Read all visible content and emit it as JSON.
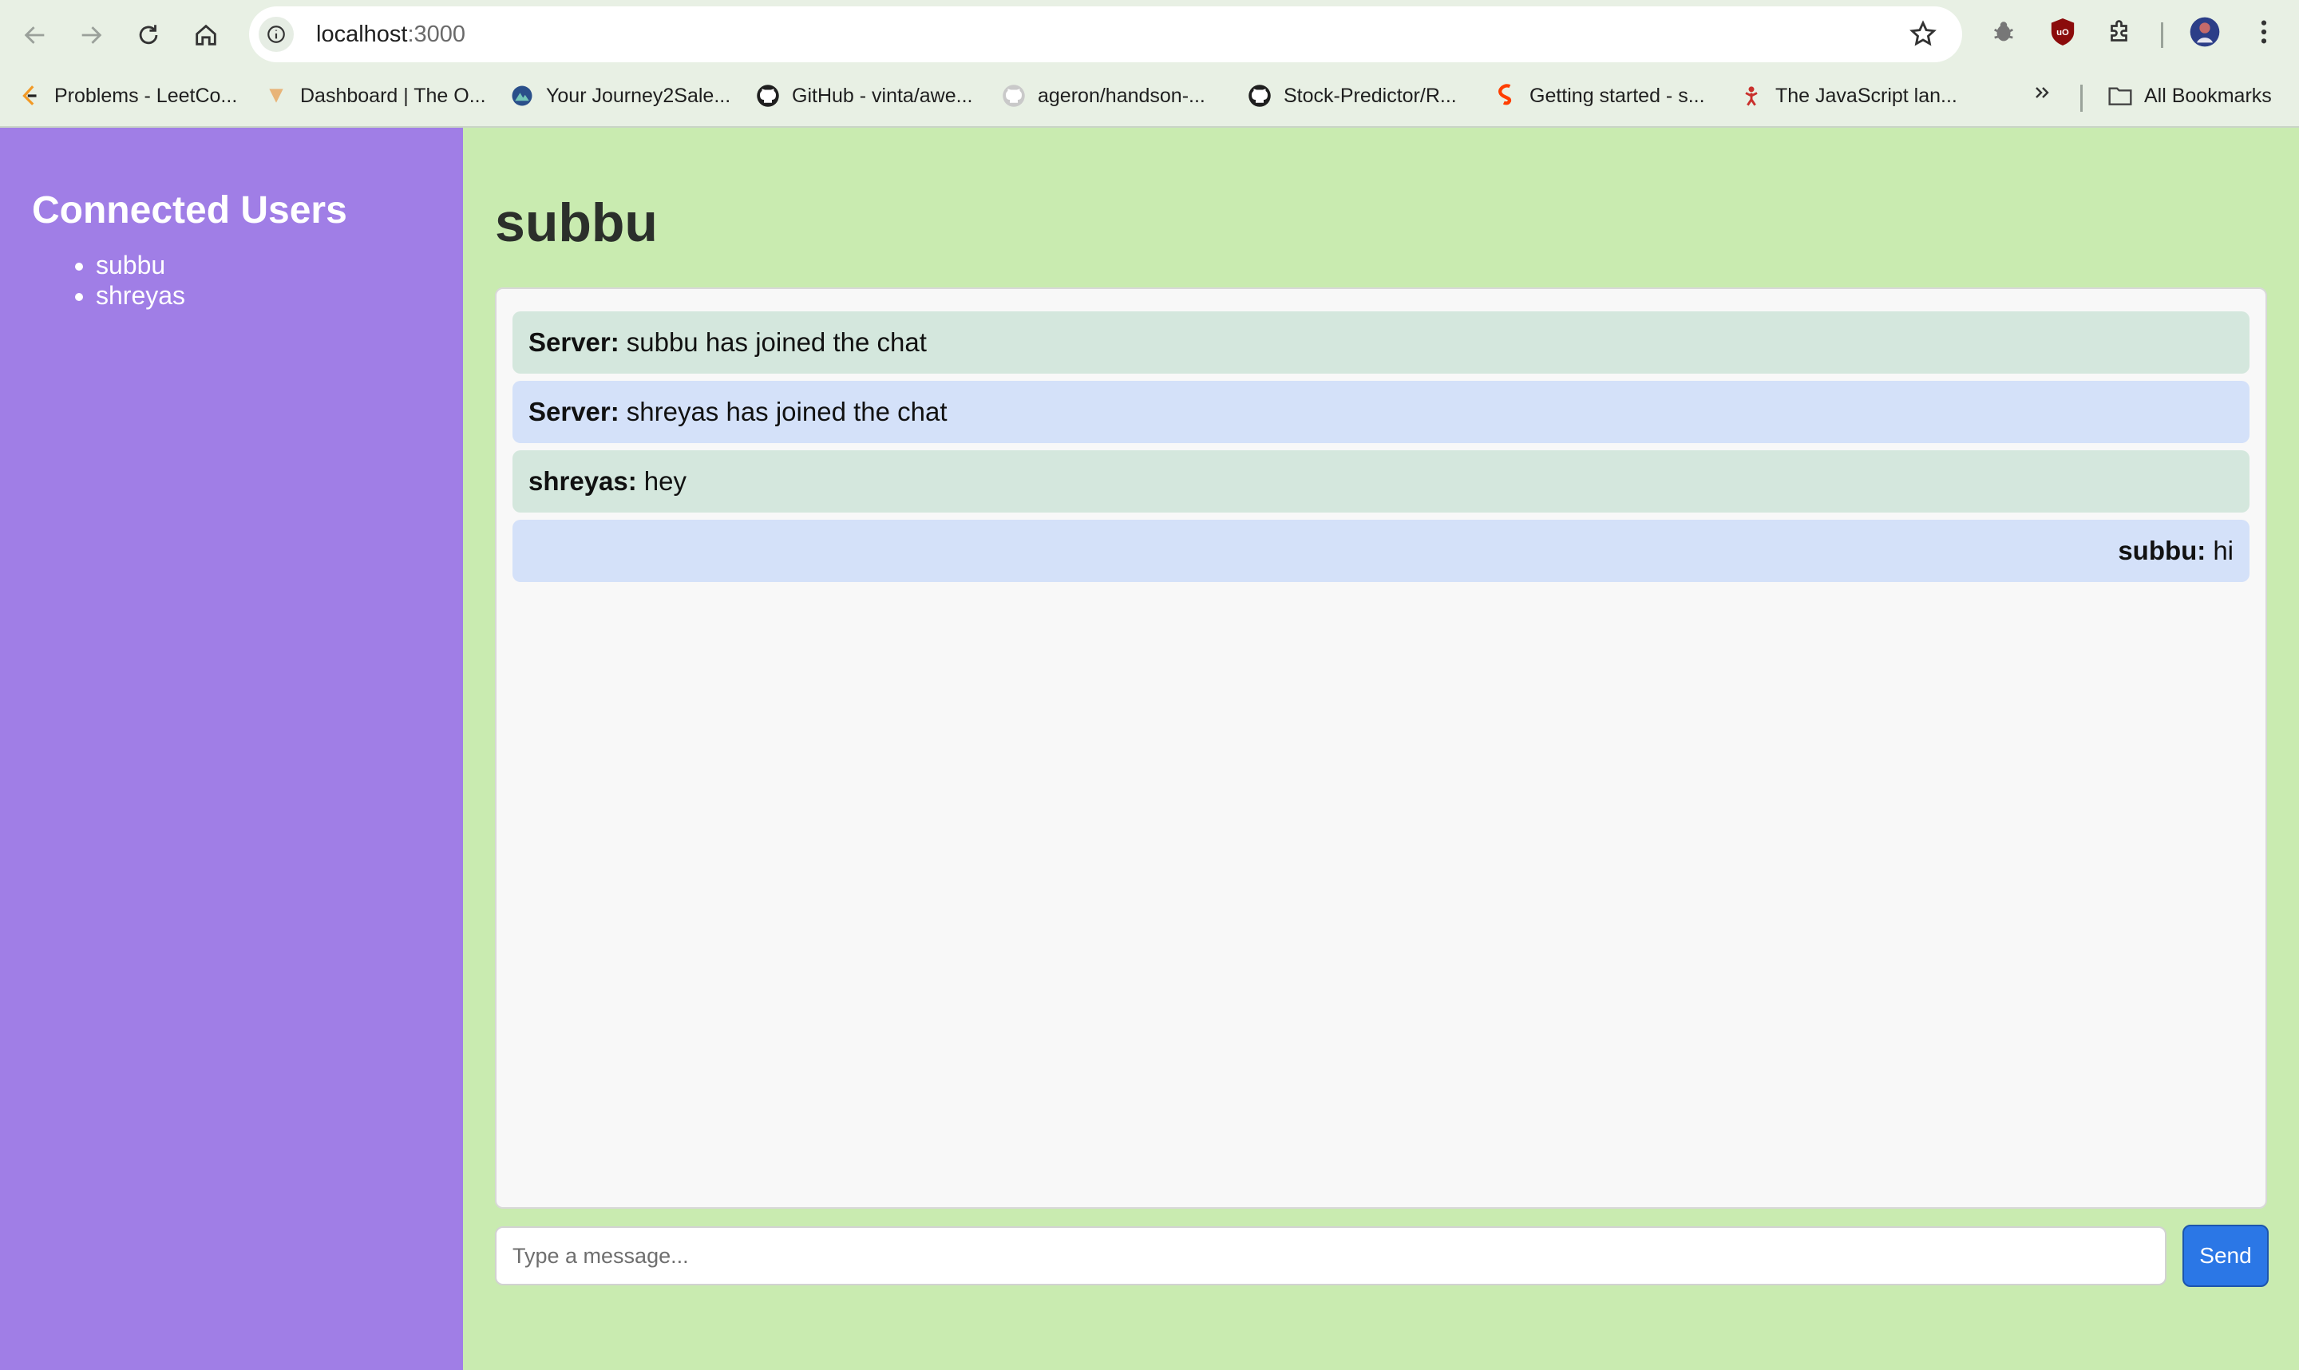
{
  "browser": {
    "url_host": "localhost",
    "url_port": ":3000",
    "bookmarks": [
      {
        "label": "Problems - LeetCo...",
        "icon": "leetcode-icon"
      },
      {
        "label": "Dashboard | The O...",
        "icon": "odin-icon"
      },
      {
        "label": "Your Journey2Sale...",
        "icon": "journey-icon"
      },
      {
        "label": "GitHub - vinta/awe...",
        "icon": "github-icon"
      },
      {
        "label": "ageron/handson-...",
        "icon": "github-icon"
      },
      {
        "label": "Stock-Predictor/R...",
        "icon": "github-icon"
      },
      {
        "label": "Getting started - s...",
        "icon": "svelte-icon"
      },
      {
        "label": "The JavaScript lan...",
        "icon": "javascript-info-icon"
      }
    ],
    "all_bookmarks_label": "All Bookmarks"
  },
  "sidebar": {
    "title": "Connected Users",
    "users": [
      "subbu",
      "shreyas"
    ]
  },
  "main": {
    "current_user": "subbu",
    "messages": [
      {
        "sender": "Server:",
        "text": "subbu has joined the chat",
        "style": "green",
        "align": "left"
      },
      {
        "sender": "Server:",
        "text": "shreyas has joined the chat",
        "style": "blue",
        "align": "left"
      },
      {
        "sender": "shreyas:",
        "text": "hey",
        "style": "green",
        "align": "left"
      },
      {
        "sender": "subbu:",
        "text": "hi",
        "style": "blue",
        "align": "right"
      }
    ],
    "input_placeholder": "Type a message...",
    "send_label": "Send"
  },
  "colors": {
    "sidebar_bg": "#a07ee6",
    "main_bg": "#c9ebb0",
    "send_button": "#2b77e6"
  }
}
